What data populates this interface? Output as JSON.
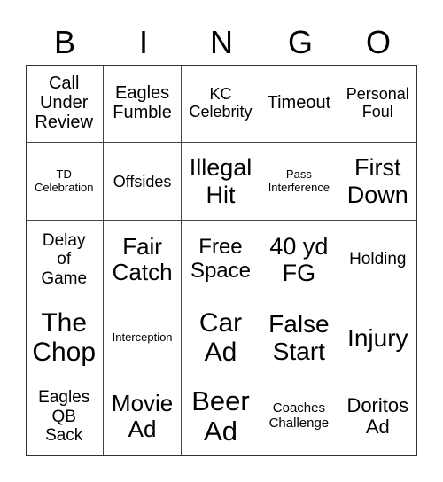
{
  "header": [
    "B",
    "I",
    "N",
    "G",
    "O"
  ],
  "cells": [
    [
      "Call Under Review",
      "Eagles Fumble",
      "KC Celebrity",
      "Timeout",
      "Personal Foul"
    ],
    [
      "TD Celebration",
      "Offsides",
      "Illegal Hit",
      "Pass Interference",
      "First Down"
    ],
    [
      "Delay of Game",
      "Fair Catch",
      "Free Space",
      "40 yd FG",
      "Holding"
    ],
    [
      "The Chop",
      "Interception",
      "Car Ad",
      "False Start",
      "Injury"
    ],
    [
      "Eagles QB Sack",
      "Movie Ad",
      "Beer Ad",
      "Coaches Challenge",
      "Doritos Ad"
    ]
  ]
}
